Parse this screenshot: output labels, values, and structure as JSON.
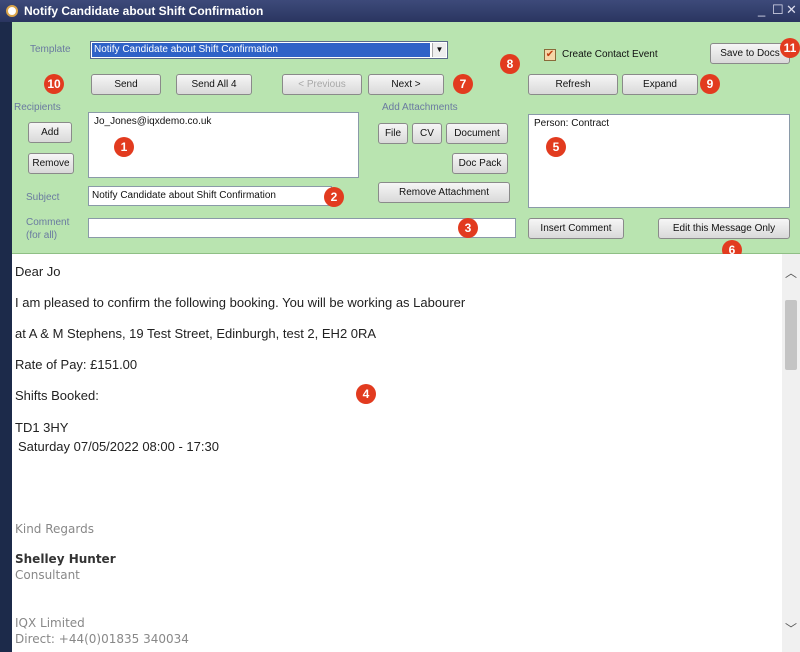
{
  "window": {
    "title": "Notify Candidate about Shift Confirmation",
    "minimize": "_",
    "maximize": "☐",
    "close": "✕"
  },
  "template": {
    "label": "Template",
    "value": "Notify Candidate about Shift Confirmation"
  },
  "toolbar": {
    "send": "Send",
    "send_all": "Send All 4",
    "previous": "< Previous",
    "next": "Next >",
    "create_contact_event": "Create Contact Event",
    "save_to_docs": "Save to Docs",
    "refresh": "Refresh",
    "expand": "Expand"
  },
  "recipients": {
    "label": "Recipients",
    "add": "Add",
    "remove": "Remove",
    "value": "Jo_Jones@iqxdemo.co.uk"
  },
  "attachments": {
    "label": "Add Attachments",
    "file": "File",
    "cv": "CV",
    "document": "Document",
    "doc_pack": "Doc Pack",
    "remove": "Remove Attachment"
  },
  "person_box": {
    "value": "Person: Contract"
  },
  "subject": {
    "label": "Subject",
    "value": "Notify Candidate about Shift Confirmation"
  },
  "comment": {
    "label_1": "Comment",
    "label_2": "(for all)",
    "value": "",
    "insert": "Insert Comment",
    "edit_only": "Edit this Message Only"
  },
  "badges": {
    "b1": "1",
    "b2": "2",
    "b3": "3",
    "b4": "4",
    "b5": "5",
    "b6": "6",
    "b7": "7",
    "b8": "8",
    "b9": "9",
    "b10": "10",
    "b11": "11"
  },
  "message": {
    "greeting": "Dear Jo",
    "line1": "I am pleased to confirm the following booking. You will be working as Labourer",
    "line2": "at A & M Stephens, 19 Test Street, Edinburgh, test 2, EH2 0RA",
    "pay": "Rate of Pay: £151.00",
    "shifts_label": "Shifts Booked:",
    "postcode": "TD1 3HY",
    "shift": "Saturday 07/05/2022 08:00 - 17:30",
    "regards": "Kind Regards",
    "sender_name": "Shelley Hunter",
    "sender_title": "Consultant",
    "company": "IQX Limited",
    "direct": "Direct: +44(0)01835 340034"
  },
  "colors": {
    "panel": "#b9e4b0",
    "badge": "#e23b1f",
    "title_bar": "#2a3560",
    "selection": "#2f62c7"
  }
}
